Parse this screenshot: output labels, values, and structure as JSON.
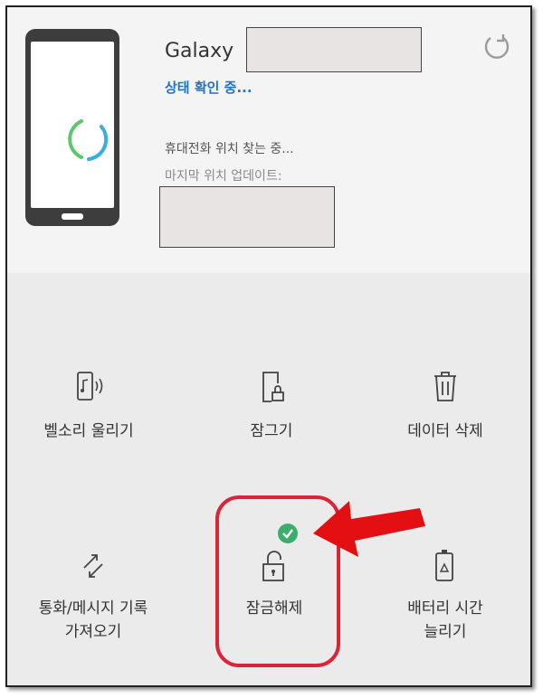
{
  "device": {
    "name": "Galaxy",
    "status": "상태 확인 중...",
    "locating": "휴대전화 위치 찾는 중...",
    "last_update_label": "마지막 위치 업데이트:"
  },
  "actions": [
    {
      "label": "벨소리 울리기",
      "icon": "ring-phone-icon"
    },
    {
      "label": "잠그기",
      "icon": "lock-phone-icon"
    },
    {
      "label": "데이터 삭제",
      "icon": "trash-icon"
    },
    {
      "label": "통화/메시지 기록\n가져오기",
      "icon": "transfer-arrows-icon"
    },
    {
      "label": "잠금해제",
      "icon": "unlock-icon",
      "enabled_badge": true
    },
    {
      "label": "배터리 시간\n늘리기",
      "icon": "battery-recycle-icon"
    }
  ],
  "colors": {
    "status_blue": "#1c73c8",
    "highlight_red": "#d9253a",
    "check_green": "#3cae6b"
  }
}
